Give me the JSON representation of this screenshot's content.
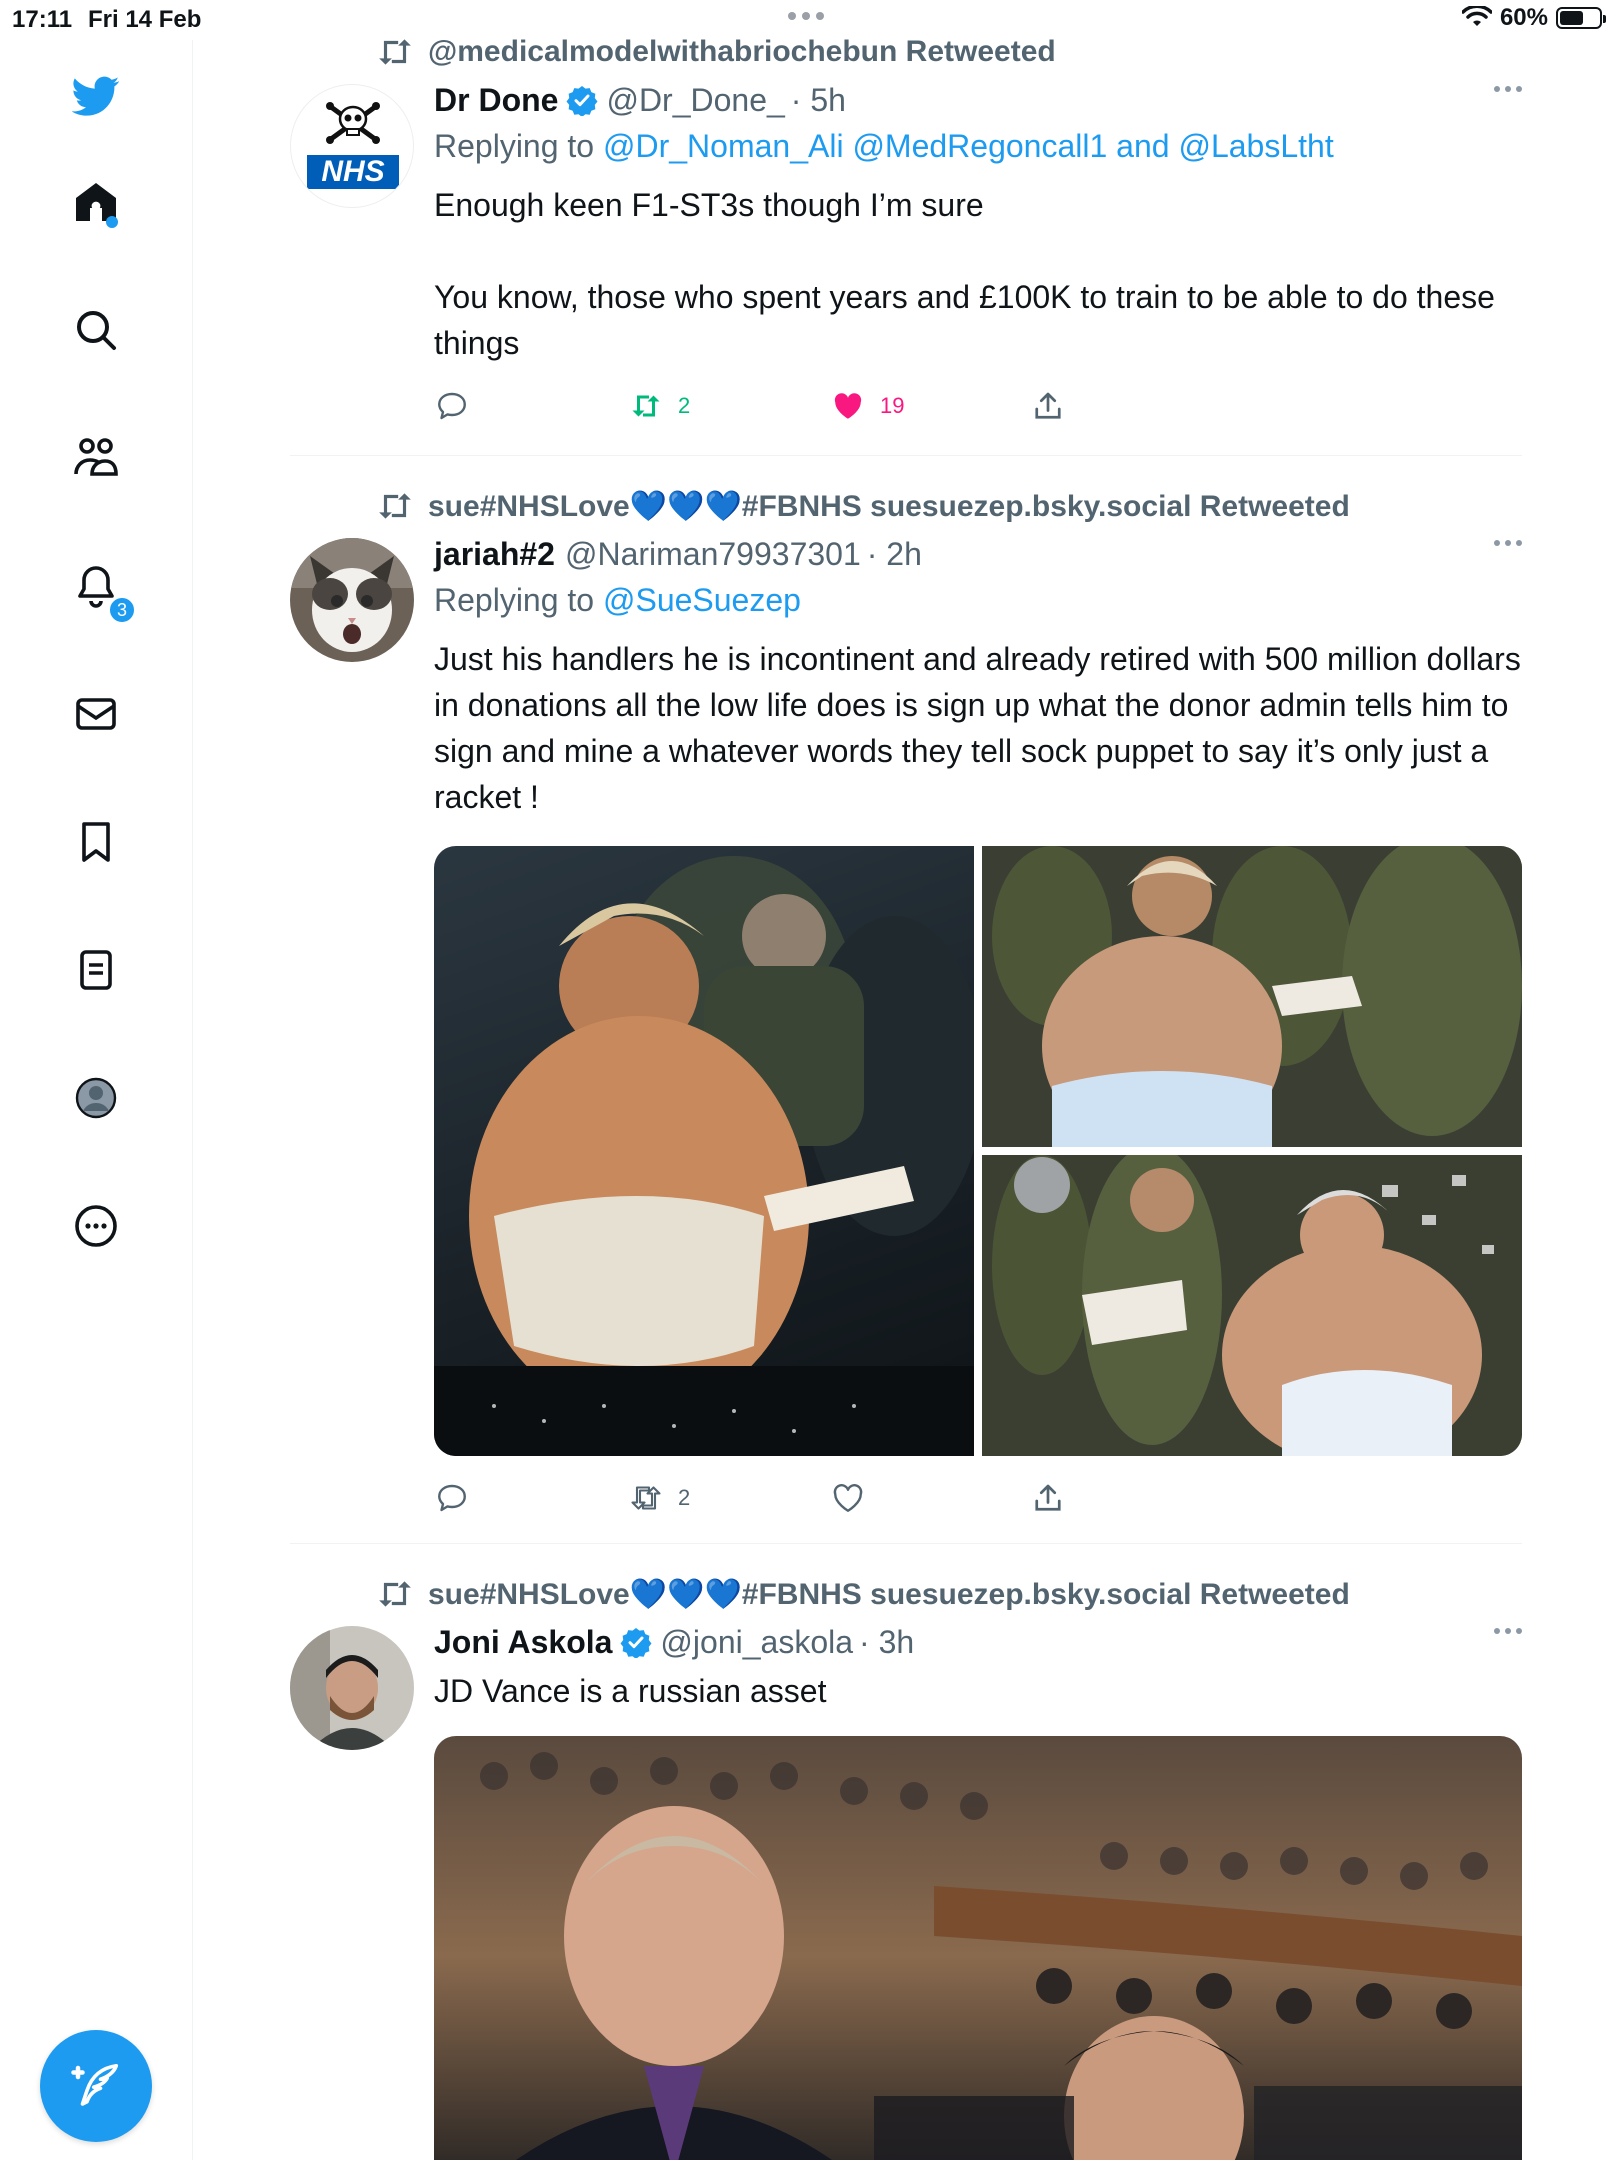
{
  "status": {
    "time": "17:11",
    "date": "Fri 14 Feb",
    "battery": "60%",
    "battery_level": 0.6
  },
  "sidebar": {
    "notifications_badge": "3",
    "items": [
      "home-icon",
      "search-icon",
      "communities-icon",
      "notifications-icon",
      "messages-icon",
      "bookmarks-icon",
      "lists-icon",
      "profile-icon",
      "more-icon"
    ],
    "compose_icon": "compose-icon"
  },
  "tweets": [
    {
      "retweeted_by": "@medicalmodelwithabriochebun Retweeted",
      "name": "Dr Done",
      "verified": true,
      "handle": "@Dr_Done_",
      "time": "· 5h",
      "replying_prefix": "Replying to",
      "replying_to": "@Dr_Noman_Ali @MedRegoncall1 and @LabsLtht",
      "text": "Enough keen F1-ST3s though I’m sure\n\nYou know, those who spent years and £100K to train to be able to do these things",
      "retweets": "2",
      "likes": "19",
      "liked": true
    },
    {
      "retweeted_by": "sue#NHSLove💙💙💙#FBNHS suesuezep.bsky.social Retweeted",
      "name": "jariah#2",
      "verified": false,
      "handle": "@Nariman79937301",
      "time": "· 2h",
      "replying_prefix": "Replying to",
      "replying_to": "@SueSuezep",
      "text": "Just his handlers he is incontinent and already retired with 500 million dollars in donations all the low life does is sign up what the donor admin tells him to sign and mine a whatever words they tell sock puppet to say it’s only just a racket !",
      "retweets": "2",
      "likes": ""
    },
    {
      "retweeted_by": "sue#NHSLove💙💙💙#FBNHS suesuezep.bsky.social Retweeted",
      "name": "Joni Askola",
      "verified": true,
      "handle": "@joni_askola",
      "time": "· 3h",
      "text": "JD Vance is a russian asset"
    }
  ],
  "colors": {
    "accent": "#1d9bf0",
    "like": "#f91880",
    "retweet": "#00ba7c",
    "muted": "#536471"
  },
  "avatar_text": {
    "nhs": "NHS"
  }
}
